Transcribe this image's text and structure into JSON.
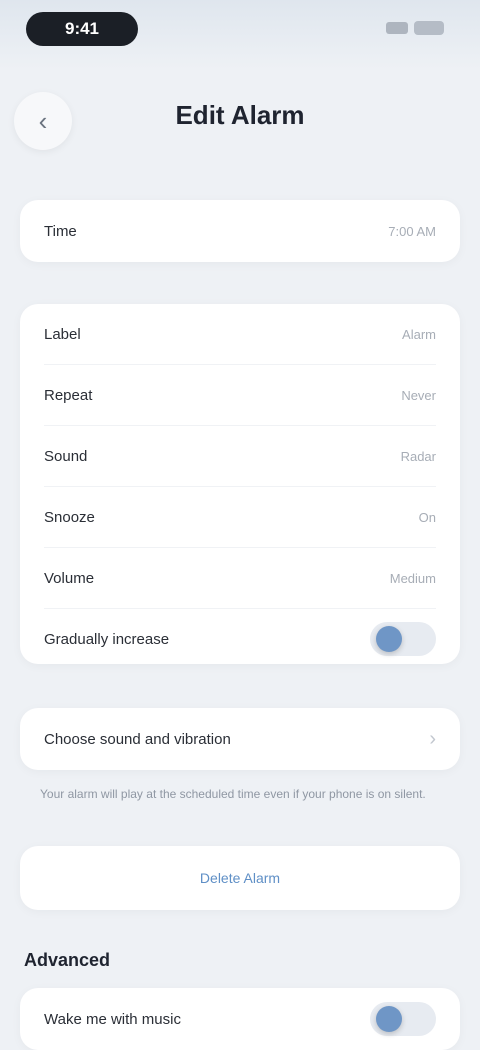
{
  "status_bar": {
    "time": "9:41"
  },
  "header": {
    "title": "Edit Alarm",
    "back_icon": "chevron-left-icon"
  },
  "alarm": {
    "label": "Time",
    "value": "7:00 AM"
  },
  "settings": {
    "rows": [
      {
        "label": "Label",
        "value": "Alarm"
      },
      {
        "label": "Repeat",
        "value": "Never"
      },
      {
        "label": "Sound",
        "value": "Radar"
      },
      {
        "label": "Snooze",
        "value": "On"
      },
      {
        "label": "Volume",
        "value": "Medium"
      },
      {
        "label": "Gradually increase",
        "toggle_on": true
      }
    ]
  },
  "sound_row": {
    "label": "Choose sound and vibration"
  },
  "help_text": "Your alarm will play at the scheduled time even if your phone is on silent.",
  "link": {
    "text": "Delete Alarm"
  },
  "section_header": "Advanced",
  "feature": {
    "label": "Wake me with music",
    "toggle_on": true
  },
  "colors": {
    "accent": "#6f96c6",
    "link": "#5f8fc6",
    "background": "#eef1f5",
    "card": "#ffffff"
  }
}
